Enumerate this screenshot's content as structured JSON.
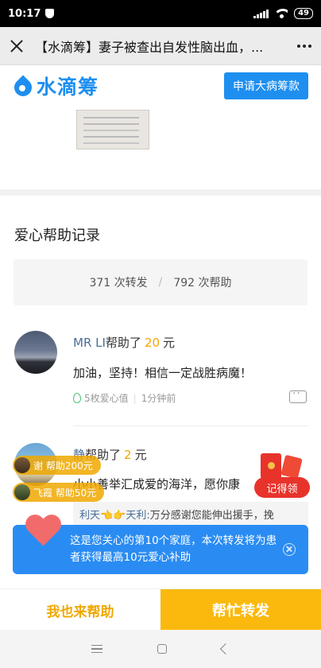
{
  "status_bar": {
    "time": "10:17",
    "battery": "49"
  },
  "title_bar": {
    "title": "【水滴筹】妻子被查出自发性脑出血，..."
  },
  "brand": {
    "name": "水滴筹",
    "apply_label": "申请大病筹款",
    "color": "#1e8ff0"
  },
  "records": {
    "title": "爱心帮助记录",
    "shares": "371 次转发",
    "stats_separator": "/",
    "helps": "792 次帮助",
    "items": [
      {
        "donor": "MR LI",
        "helped": "帮助了",
        "amount": "20",
        "unit": "元",
        "message": "加油，坚持！相信一定战胜病魔！",
        "love_value": "5枚爱心值",
        "time": "1分钟前"
      },
      {
        "donor": "静",
        "helped": "帮助了",
        "amount": "2",
        "unit": "元",
        "message": "小小善举汇成爱的海洋，愿你康",
        "reply_names": "利天👈👉天利:",
        "reply_text": " 万分感谢您能伸出援手，挽"
      }
    ]
  },
  "toasts": [
    {
      "text": "谢  帮助200元"
    },
    {
      "text": "飞霞  帮助50元"
    }
  ],
  "claim": {
    "label": "记得领"
  },
  "banner": {
    "text": "这是您关心的第10个家庭，本次转发将为患者获得最高10元爱心补助"
  },
  "actions": {
    "help_label": "我也来帮助",
    "share_label": "帮忙转发"
  },
  "colors": {
    "accent": "#fbb90e",
    "amount": "#f0a800",
    "banner": "#2a8cf2",
    "red": "#e8332b"
  }
}
